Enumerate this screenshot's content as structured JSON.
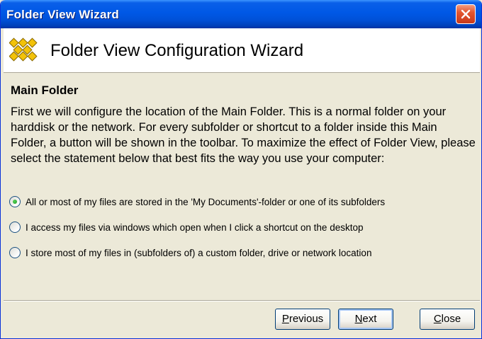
{
  "window": {
    "title": "Folder View Wizard"
  },
  "header": {
    "title": "Folder View Configuration Wizard",
    "logo_icon": "folder-view-logo"
  },
  "section": {
    "title": "Main Folder",
    "description": "First we will configure the location of the Main Folder. This is a normal folder on your harddisk or the network. For every subfolder or shortcut to a folder inside this Main Folder, a button will be shown in the toolbar. To maximize the effect of Folder View, please select the statement below that best fits the way you use your computer:"
  },
  "options": [
    {
      "label": "All or most of my files are stored in the 'My Documents'-folder or one of its subfolders",
      "checked": true
    },
    {
      "label": "I access my files via windows which open when I click a shortcut on the desktop",
      "checked": false
    },
    {
      "label": "I store most of my files in (subfolders of) a custom folder, drive or network location",
      "checked": false
    }
  ],
  "buttons": {
    "previous": {
      "mnemonic": "P",
      "rest": "revious"
    },
    "next": {
      "mnemonic": "N",
      "rest": "ext"
    },
    "close": {
      "mnemonic": "C",
      "rest": "lose"
    }
  },
  "colors": {
    "titlebar": "#0058e6",
    "window_bg": "#ece9d8",
    "close_button": "#e3562f",
    "logo": "#f2c20a"
  }
}
